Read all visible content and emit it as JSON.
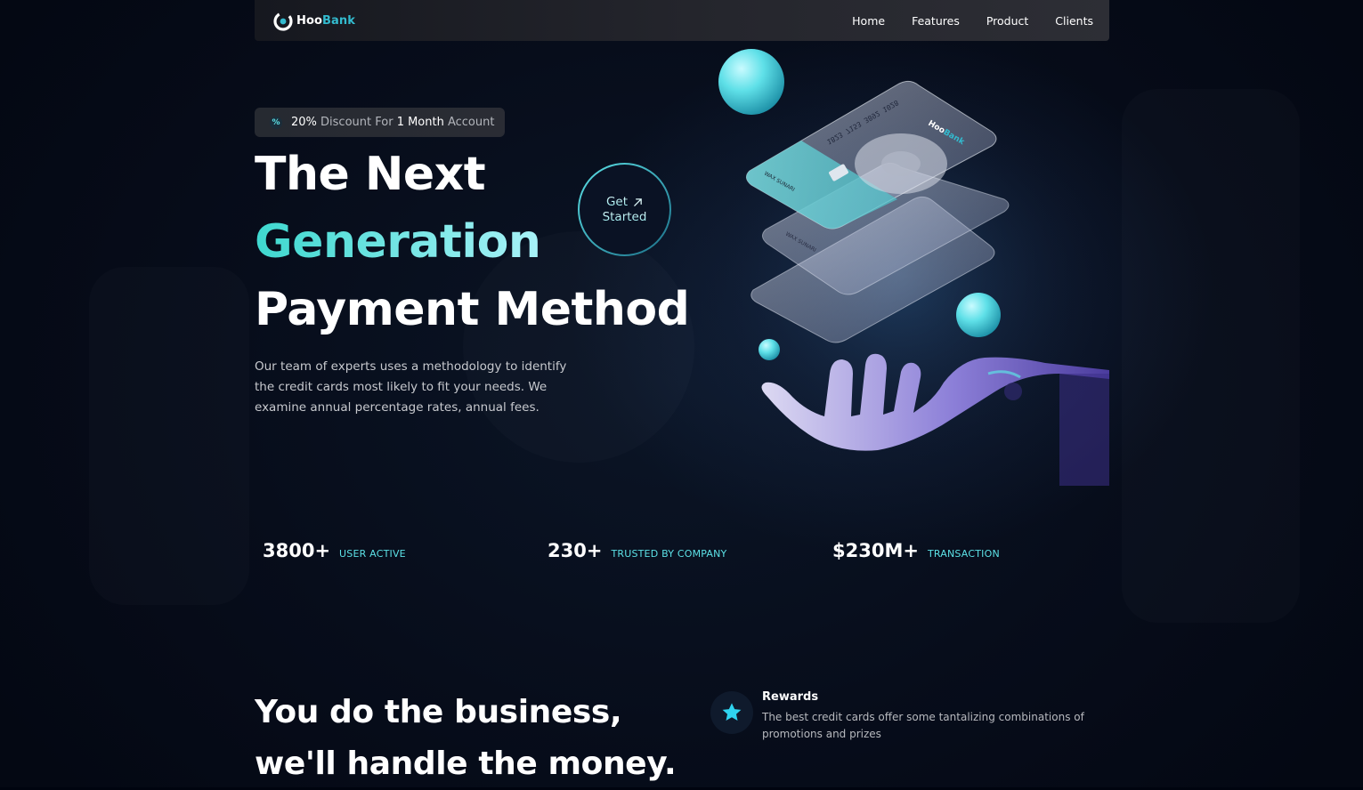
{
  "navbar": {
    "logo": {
      "name": "Hoo",
      "accent": "Bank"
    },
    "links": [
      "Home",
      "Features",
      "Product",
      "Clients"
    ]
  },
  "hero": {
    "badge": {
      "icon": "percent-icon",
      "parts": [
        "20%",
        " Discount For ",
        "1 Month",
        " Account"
      ]
    },
    "title_line_1": "The Next",
    "title_line_2": "Generation",
    "title_line_3": "Payment Method",
    "cta": {
      "line_1": "Get",
      "line_2": "Started",
      "icon": "arrow-up-right-icon"
    },
    "description": "Our team of experts uses a methodology to identify the credit cards most likely to fit your needs. We examine annual percentage rates, annual fees.",
    "illustration": {
      "card_number": "1823 7153 3892 1028",
      "card_holder": "WAX SUNARI",
      "card_brand": {
        "name": "Hoo",
        "accent": "Bank"
      }
    }
  },
  "stats": [
    {
      "value": "3800+",
      "label": "USER ACTIVE"
    },
    {
      "value": "230+",
      "label": "TRUSTED BY COMPANY"
    },
    {
      "value": "$230M+",
      "label": "TRANSACTION"
    }
  ],
  "business": {
    "heading_line_1": "You do the business,",
    "heading_line_2": "we'll handle the money.",
    "feature": {
      "icon": "star-icon",
      "title": "Rewards",
      "description": "The best credit cards offer some tantalizing combinations of promotions and prizes"
    }
  },
  "colors": {
    "background": "#00040f",
    "accent": "#5ce1e6",
    "gradient_start": "#3ed8cf",
    "text_muted": "#c7c9ce"
  }
}
